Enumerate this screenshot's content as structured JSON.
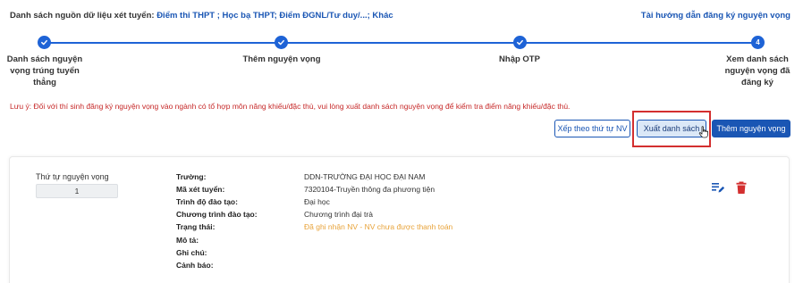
{
  "header": {
    "sources_label": "Danh sách nguồn dữ liệu xét tuyển:",
    "sources_values": "Điểm thi THPT ; Học bạ THPT; Điểm ĐGNL/Tư duy/...; Khác",
    "guide_link": "Tài hướng dẫn đăng ký nguyện vọng"
  },
  "stepper": {
    "steps": [
      {
        "label_lines": [
          "Danh sách nguyện",
          "vọng trúng tuyển",
          "thẳng"
        ],
        "state": "done"
      },
      {
        "label_lines": [
          "Thêm nguyện vọng"
        ],
        "state": "done"
      },
      {
        "label_lines": [
          "Nhập OTP"
        ],
        "state": "done"
      },
      {
        "label_lines": [
          "Xem danh sách",
          "nguyện vọng đã",
          "đăng ký"
        ],
        "state": "current",
        "number": "4"
      }
    ]
  },
  "notice": "Lưu ý: Đối với thí sinh đăng ký nguyện vọng vào ngành có tổ hợp môn năng khiếu/đặc thù, vui lòng xuất danh sách nguyện vọng để kiểm tra điểm năng khiếu/đặc thù.",
  "actions": {
    "sort_label": "Xếp theo thứ tự NV",
    "export_label": "Xuất danh sách",
    "add_label": "Thêm nguyện vọng"
  },
  "card": {
    "order_label": "Thứ tự nguyện vọng",
    "order_value": "1",
    "fields": [
      {
        "label": "Trường:",
        "value": "DDN-TRƯỜNG ĐẠI HỌC ĐẠI NAM"
      },
      {
        "label": "Mã xét tuyển:",
        "value": "7320104-Truyền thông đa phương tiện"
      },
      {
        "label": "Trình độ đào tạo:",
        "value": "Đại học"
      },
      {
        "label": "Chương trình đào tạo:",
        "value": "Chương trình đại trà"
      },
      {
        "label": "Trạng thái:",
        "value": "Đã ghi nhận NV - NV chưa được thanh toán"
      },
      {
        "label": "Mô tả:",
        "value": ""
      },
      {
        "label": "Ghi chú:",
        "value": ""
      },
      {
        "label": "Cảnh báo:",
        "value": ""
      }
    ]
  },
  "colors": {
    "primary": "#1a56b4",
    "step": "#1e63d6",
    "notice": "#c62828",
    "status": "#e8a33a",
    "delete": "#d32f2f",
    "highlight": "#d32f2f"
  },
  "icons": {
    "edit": "edit-list-icon",
    "delete": "trash-icon",
    "check": "check-icon",
    "cursor": "hand-pointer-icon"
  }
}
